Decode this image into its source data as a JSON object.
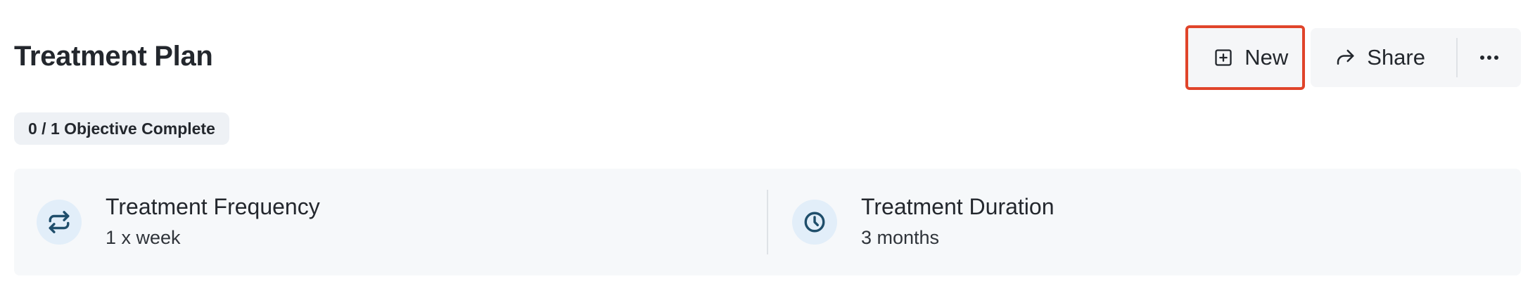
{
  "header": {
    "title": "Treatment Plan"
  },
  "toolbar": {
    "new_label": "New",
    "share_label": "Share",
    "new_icon": "plus-square-icon",
    "share_icon": "share-arrow-icon",
    "more_icon": "more-horizontal-icon",
    "highlight_color": "#e0442a"
  },
  "progress": {
    "badge_text": "0 / 1 Objective Complete",
    "completed": 0,
    "total": 1
  },
  "details": {
    "frequency": {
      "label": "Treatment Frequency",
      "value": "1 x week",
      "icon": "repeat-icon"
    },
    "duration": {
      "label": "Treatment Duration",
      "value": "3 months",
      "icon": "clock-icon"
    },
    "icon_color": "#1f4e6b",
    "icon_bg": "#e2eef9"
  }
}
